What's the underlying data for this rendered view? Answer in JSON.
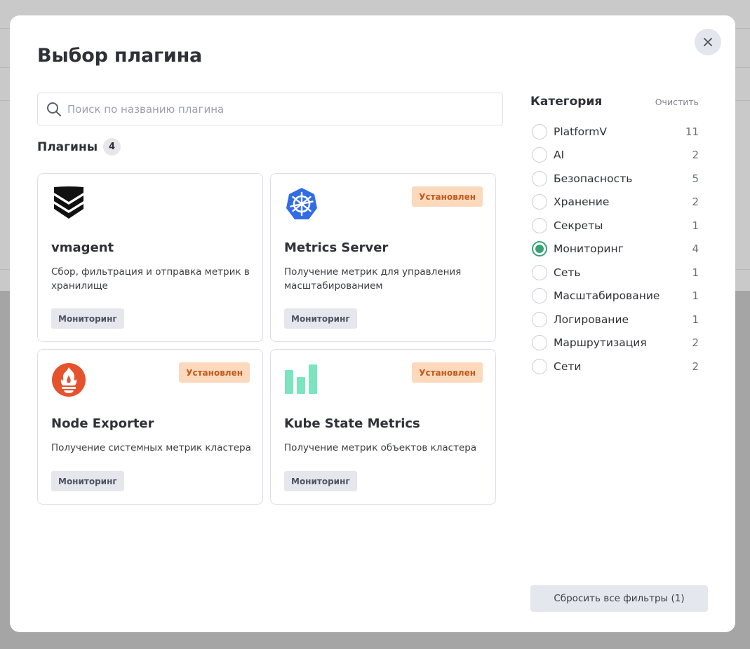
{
  "dialog": {
    "title": "Выбор плагина",
    "close_icon": "close-icon"
  },
  "search": {
    "placeholder": "Поиск по названию плагина",
    "value": "",
    "icon": "search-icon"
  },
  "plugins": {
    "label": "Плагины",
    "count": "4",
    "items": [
      {
        "name": "vmagent",
        "description": "Сбор, фильтрация и отправка метрик в хранилище",
        "tag": "Мониторинг",
        "status": "",
        "icon": "vmagent-logo"
      },
      {
        "name": "Metrics Server",
        "description": "Получение метрик для управления масштабированием",
        "tag": "Мониторинг",
        "status": "Установлен",
        "icon": "kubernetes-logo"
      },
      {
        "name": "Node Exporter",
        "description": "Получение системных метрик кластера",
        "tag": "Мониторинг",
        "status": "Установлен",
        "icon": "prometheus-logo"
      },
      {
        "name": "Kube State Metrics",
        "description": "Получение метрик объектов кластера",
        "tag": "Мониторинг",
        "status": "Установлен",
        "icon": "bar-chart-logo"
      }
    ]
  },
  "category": {
    "label": "Категория",
    "clear_label": "Очистить",
    "items": [
      {
        "name": "PlatformV",
        "count": "11",
        "checked": false
      },
      {
        "name": "AI",
        "count": "2",
        "checked": false
      },
      {
        "name": "Безопасность",
        "count": "5",
        "checked": false
      },
      {
        "name": "Хранение",
        "count": "2",
        "checked": false
      },
      {
        "name": "Секреты",
        "count": "1",
        "checked": false
      },
      {
        "name": "Мониторинг",
        "count": "4",
        "checked": true
      },
      {
        "name": "Сеть",
        "count": "1",
        "checked": false
      },
      {
        "name": "Масштабирование",
        "count": "1",
        "checked": false
      },
      {
        "name": "Логирование",
        "count": "1",
        "checked": false
      },
      {
        "name": "Маршрутизация",
        "count": "2",
        "checked": false
      },
      {
        "name": "Сети",
        "count": "2",
        "checked": false
      }
    ]
  },
  "reset_button_label": "Сбросить все фильтры (1)",
  "colors": {
    "accent_green": "#3aa276",
    "installed_bg": "#fcd9bd",
    "installed_text": "#c05a1c",
    "kubernetes_blue": "#326ce5",
    "prometheus_orange": "#e6522c",
    "chart_mint": "#7ae5be"
  }
}
